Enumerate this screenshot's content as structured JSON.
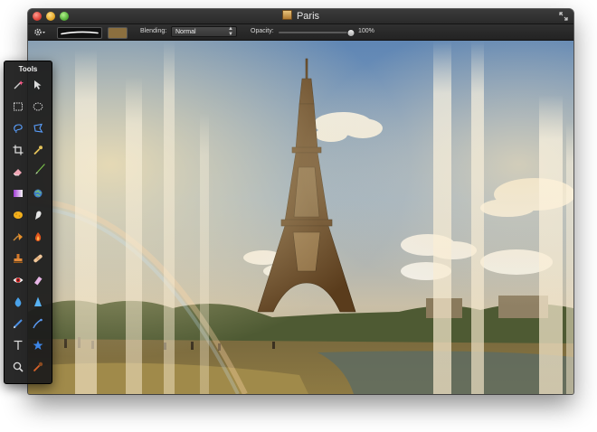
{
  "window": {
    "title": "Paris"
  },
  "toolbar": {
    "blending_label": "Blending:",
    "blending_value": "Normal",
    "opacity_label": "Opacity:",
    "opacity_value": "100%",
    "opacity_fraction": 1.0,
    "primary_color": "#8b6f3f"
  },
  "tools_palette": {
    "title": "Tools",
    "tools": [
      "magic-wand",
      "move",
      "rectangle-select",
      "ellipse-select",
      "lasso",
      "polygon-lasso",
      "crop",
      "eyedropper",
      "eraser",
      "brush",
      "gradient",
      "clone-globe",
      "sponge",
      "smudge",
      "paint-bucket",
      "burn",
      "stamp",
      "bandage",
      "red-eye",
      "eraser-alt",
      "blur-drop",
      "sharpen",
      "pencil",
      "pen",
      "text",
      "shape-star",
      "zoom",
      "color-picker"
    ]
  }
}
